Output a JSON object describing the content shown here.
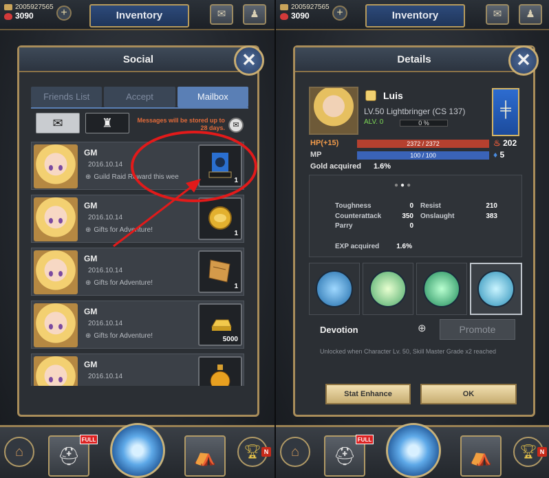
{
  "colors": {
    "accent_blue": "#5a7fb5",
    "panel_border": "#a98d5a",
    "warning_text": "#e36b3a",
    "annotation_red": "#e21a1a",
    "hp_bar": "#b5402f",
    "mp_bar": "#3a63b8",
    "alv_green": "#7ed957"
  },
  "left": {
    "topbar": {
      "gold": "2005927565",
      "rubies": "3090",
      "title": "Inventory",
      "plus_icon": "plus-icon",
      "mail_icon": "mail-icon",
      "character_icon": "character-icon"
    },
    "panel": {
      "title": "Social",
      "tabs": [
        {
          "label": "Friends List",
          "active": false
        },
        {
          "label": "Accept",
          "active": false
        },
        {
          "label": "Mailbox",
          "active": true
        }
      ],
      "store_message": "Messages will be stored up to 28 days.",
      "mails": [
        {
          "sender": "GM",
          "date": "2016.10.14",
          "subject": "Guild Raid Reward this wee",
          "item_icon": "guild-banner-icon",
          "qty": "1"
        },
        {
          "sender": "GM",
          "date": "2016.10.14",
          "subject": "Gifts for Adventure!",
          "item_icon": "gold-coin-icon",
          "qty": "1"
        },
        {
          "sender": "GM",
          "date": "2016.10.14",
          "subject": "Gifts for Adventure!",
          "item_icon": "scroll-ticket-icon",
          "qty": "1"
        },
        {
          "sender": "GM",
          "date": "2016.10.14",
          "subject": "Gifts for Adventure!",
          "item_icon": "gold-bar-icon",
          "qty": "5000"
        },
        {
          "sender": "GM",
          "date": "2016.10.14",
          "subject": "",
          "item_icon": "potion-icon",
          "qty": ""
        }
      ]
    },
    "bottombar": {
      "full_badge": "FULL",
      "n_badge": "N"
    }
  },
  "right": {
    "topbar": {
      "gold": "2005927565",
      "rubies": "3090",
      "title": "Inventory"
    },
    "panel": {
      "title": "Details",
      "char_name": "Luis",
      "char_class": "LV.50 Lightbringer (CS 137)",
      "alv": "ALV. 0",
      "alv_progress": "0 %",
      "hp_label": "HP(+15)",
      "hp_value": "2372 / 2372",
      "hp_side": "202",
      "mp_label": "MP",
      "mp_value": "100 / 100",
      "mp_side": "5",
      "gold_label": "Gold acquired",
      "gold_value": "1.6%",
      "stats": {
        "toughness_label": "Toughness",
        "toughness": "0",
        "resist_label": "Resist",
        "resist": "210",
        "counter_label": "Counterattack",
        "counter": "350",
        "onslaught_label": "Onslaught",
        "onslaught": "383",
        "parry_label": "Parry",
        "parry": "0",
        "exp_label": "EXP acquired",
        "exp": "1.6%"
      },
      "devotion": "Devotion",
      "promote": "Promote",
      "unlock_text": "Unlocked when Character Lv. 50, Skill Master Grade x2 reached",
      "stat_enhance": "Stat Enhance",
      "ok": "OK"
    },
    "bottombar": {
      "full_badge": "FULL",
      "n_badge": "N"
    }
  }
}
